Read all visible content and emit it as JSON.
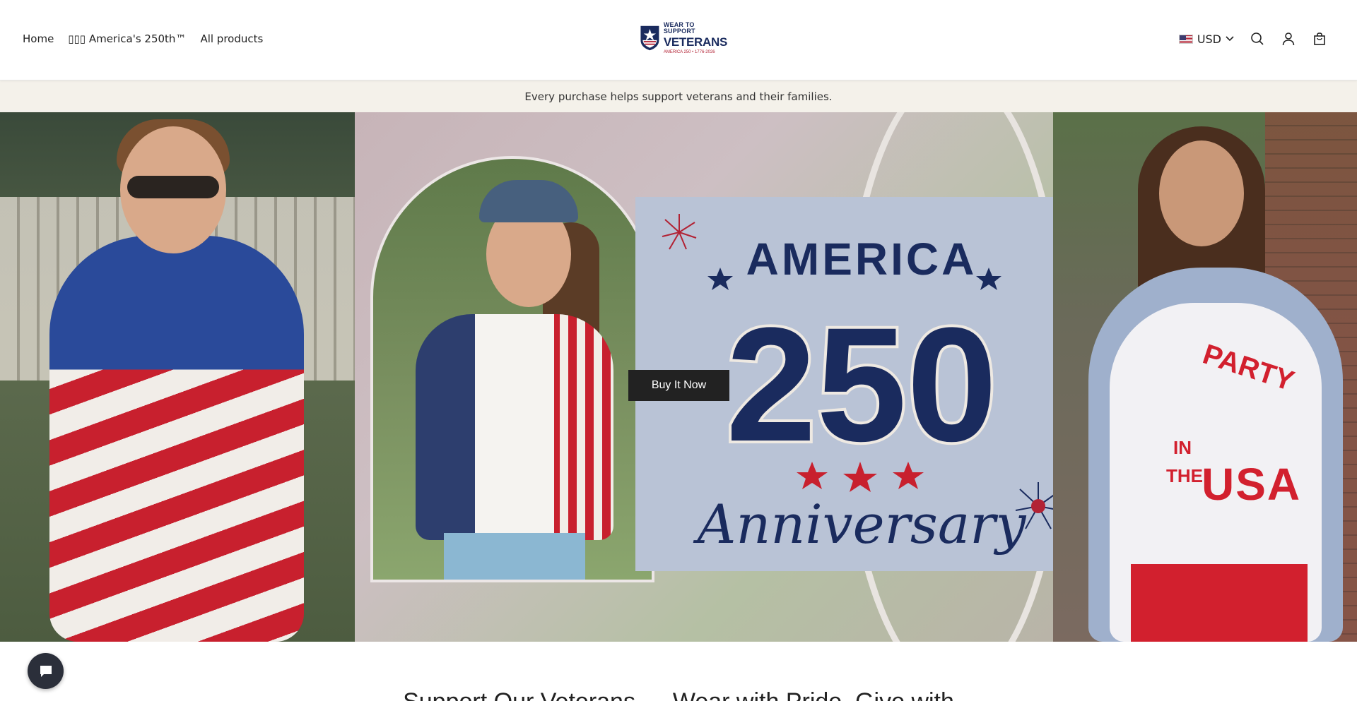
{
  "header": {
    "nav": [
      {
        "label": "Home"
      },
      {
        "label": "▯▯▯ America's 250th™"
      },
      {
        "label": "All products"
      }
    ],
    "logo": {
      "line1": "WEAR TO SUPPORT",
      "line2": "VETERANS",
      "line3": "AMERICA 250 • 1776-2026"
    },
    "currency": "USD",
    "icons": [
      "search-icon",
      "account-icon",
      "cart-icon",
      "chevron-down-icon"
    ]
  },
  "announcement": "Every purchase helps support veterans and their families.",
  "hero": {
    "card": {
      "top": "AMERICA",
      "number": "250",
      "bottom": "Anniversary"
    },
    "tee_text_small": "PARTY",
    "tee_text_in": "IN",
    "tee_text_the": "THE",
    "tee_text_big": "USA",
    "button_label": "Buy It Now"
  },
  "section": {
    "heading": "Support Our Veterans — Wear with Pride, Give with"
  },
  "colors": {
    "navy": "#1a2b5e",
    "red": "#c8202e",
    "announce_bg": "#f4f1ea",
    "button_bg": "#222222"
  }
}
